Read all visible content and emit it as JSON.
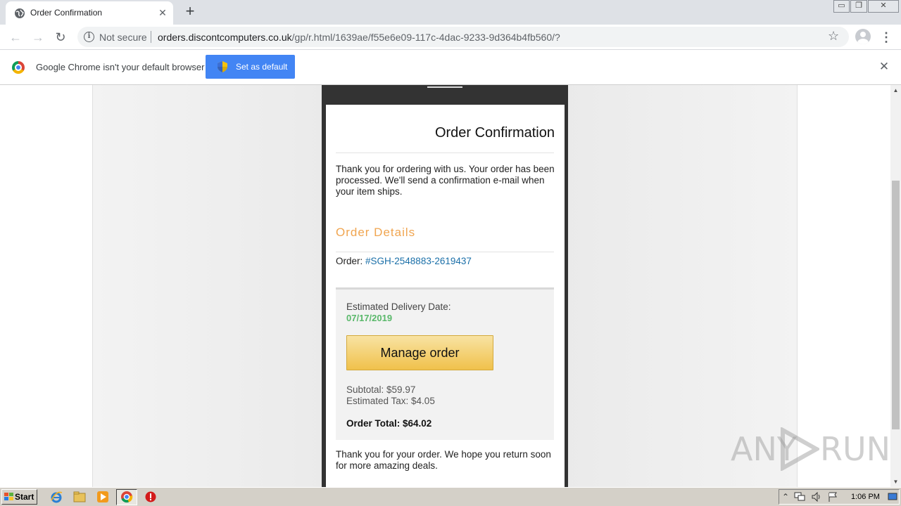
{
  "browser": {
    "tab": {
      "title": "Order Confirmation",
      "close": "✕"
    },
    "new_tab": "+",
    "window_controls": {
      "minimize": "▭",
      "restore": "❐",
      "close": "✕"
    },
    "nav": {
      "back": "←",
      "forward": "→",
      "reload": "↻"
    },
    "omnibox": {
      "info_glyph": "i",
      "security_label": "Not secure",
      "url_host": "orders.discontcomputers.co.uk",
      "url_path": "/gp/r.html/1639ae/f55e6e09-117c-4dac-9233-9d364b4fb560/?"
    },
    "bookmark_glyph": "☆",
    "menu_glyph": "⋮"
  },
  "infobar": {
    "message": "Google Chrome isn't your default browser",
    "button_label": "Set as default",
    "close": "✕"
  },
  "email": {
    "title": "Order Confirmation",
    "intro": "Thank you for ordering with us. Your order has been processed. We'll send a confirmation e-mail when your item ships.",
    "details_heading": "Order Details",
    "order_label": "Order: ",
    "order_number": "#SGH-2548883-2619437",
    "delivery_label": "Estimated Delivery Date:",
    "delivery_date": "07/17/2019",
    "manage_button": "Manage order",
    "subtotal": "Subtotal: $59.97",
    "tax": "Estimated Tax: $4.05",
    "total": "Order Total: $64.02",
    "closing": "Thank you for your order. We hope you return soon for more amazing deals."
  },
  "watermark": {
    "left": "ANY",
    "right": "RUN"
  },
  "scrollbar": {
    "up": "▲",
    "down": "▼"
  },
  "taskbar": {
    "start_label": "Start",
    "clock": "1:06 PM"
  },
  "colors": {
    "accent_orange": "#f0a550",
    "date_green": "#59b86a",
    "link_blue": "#1a6fa8",
    "button_blue": "#4285f4",
    "manage_button_yellow": "#f0c14b"
  },
  "icons": [
    "globe-icon",
    "info-icon",
    "star-icon",
    "profile-icon",
    "menu-icon",
    "chrome-logo-icon",
    "shield-icon",
    "windows-logo-icon",
    "ie-icon",
    "folder-icon",
    "media-player-icon",
    "chrome-icon",
    "stop-icon"
  ]
}
